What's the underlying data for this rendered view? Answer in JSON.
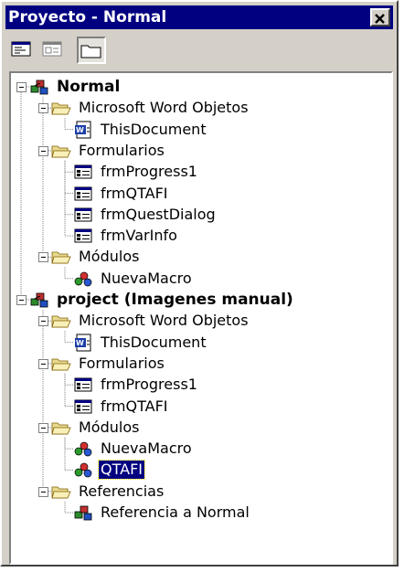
{
  "window": {
    "title": "Proyecto - Normal"
  },
  "toolbar": {
    "buttons": [
      {
        "icon": "view-code-icon"
      },
      {
        "icon": "view-object-icon"
      },
      {
        "icon": "toggle-folders-icon",
        "pressed": true
      }
    ]
  },
  "tree": {
    "nodes": [
      {
        "label": "Normal",
        "level": 0,
        "icon": "project",
        "bold": true,
        "expanded": true
      },
      {
        "label": "Microsoft Word Objetos",
        "level": 1,
        "icon": "folder-open",
        "expanded": true
      },
      {
        "label": "ThisDocument",
        "level": 2,
        "icon": "word-document"
      },
      {
        "label": "Formularios",
        "level": 1,
        "icon": "folder-open",
        "expanded": true
      },
      {
        "label": "frmProgress1",
        "level": 2,
        "icon": "form"
      },
      {
        "label": "frmQTAFI",
        "level": 2,
        "icon": "form"
      },
      {
        "label": "frmQuestDialog",
        "level": 2,
        "icon": "form"
      },
      {
        "label": "frmVarInfo",
        "level": 2,
        "icon": "form"
      },
      {
        "label": "Módulos",
        "level": 1,
        "icon": "folder-open",
        "expanded": true
      },
      {
        "label": "NuevaMacro",
        "level": 2,
        "icon": "module"
      },
      {
        "label": "project (Imagenes manual)",
        "level": 0,
        "icon": "project",
        "bold": true,
        "expanded": true
      },
      {
        "label": "Microsoft Word Objetos",
        "level": 1,
        "icon": "folder-open",
        "expanded": true
      },
      {
        "label": "ThisDocument",
        "level": 2,
        "icon": "word-document"
      },
      {
        "label": "Formularios",
        "level": 1,
        "icon": "folder-open",
        "expanded": true
      },
      {
        "label": "frmProgress1",
        "level": 2,
        "icon": "form"
      },
      {
        "label": "frmQTAFI",
        "level": 2,
        "icon": "form"
      },
      {
        "label": "Módulos",
        "level": 1,
        "icon": "folder-open",
        "expanded": true
      },
      {
        "label": "NuevaMacro",
        "level": 2,
        "icon": "module"
      },
      {
        "label": "QTAFI",
        "level": 2,
        "icon": "module",
        "selected": true
      },
      {
        "label": "Referencias",
        "level": 1,
        "icon": "folder-open",
        "expanded": true
      },
      {
        "label": "Referencia a Normal",
        "level": 2,
        "icon": "reference"
      }
    ]
  },
  "colors": {
    "titlebar": "#000080",
    "face": "#d4d0c8",
    "selection": "#000080"
  }
}
